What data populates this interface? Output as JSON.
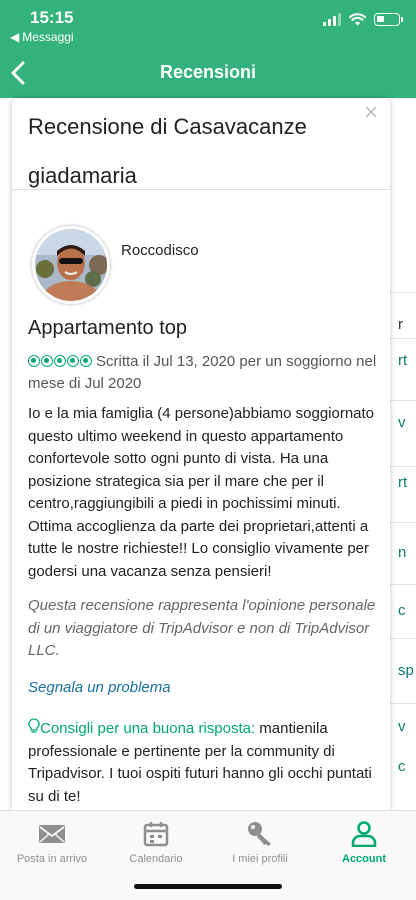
{
  "status_bar": {
    "time": "15:15",
    "back_app": "Messaggi",
    "battery_level": 0.35
  },
  "nav": {
    "title": "Recensioni"
  },
  "modal": {
    "title": "Recensione di Casavacanze giadamaria",
    "close_symbol": "×"
  },
  "review": {
    "reviewer": "Roccodisco",
    "title": "Appartamento top",
    "rating": 5,
    "rating_max": 5,
    "meta": "Scritta il Jul 13, 2020 per un soggiorno nel mese di Jul 2020",
    "body": "Io e la mia famiglia (4 persone)abbiamo soggiornato questo ultimo weekend in questo appartamento confortevole sotto ogni punto di vista. Ha una posizione strategica sia per il mare che per il centro,raggiungibili a piedi in pochissimi minuti. Ottima accoglienza da parte dei proprietari,attenti a tutte le nostre richieste!! Lo consiglio vivamente per godersi una vacanza senza pensieri!",
    "disclaimer": "Questa recensione rappresenta l'opinione personale di un viaggiatore di TripAdvisor e non di TripAdvisor LLC.",
    "report_link": "Segnala un problema",
    "tips_label": "Consigli per una buona risposta:",
    "tips_text": " mantienila professionale e pertinente per la community di Tripadvisor. I tuoi ospiti futuri hanno gli occhi puntati su di te!"
  },
  "background_fragments": [
    "r",
    "rt",
    "v",
    "rt",
    "n",
    "c",
    "c",
    "sp",
    "v",
    "c"
  ],
  "tabbar": {
    "tabs": [
      {
        "label": "Posta in arrivo",
        "icon": "envelope-icon"
      },
      {
        "label": "Calendario",
        "icon": "calendar-icon"
      },
      {
        "label": "I miei profili",
        "icon": "key-icon"
      },
      {
        "label": "Account",
        "icon": "person-icon",
        "active": true
      }
    ]
  },
  "colors": {
    "header_green": "#34b27d",
    "accent_green": "#00aa6c",
    "link_blue": "#1a6fa1"
  }
}
